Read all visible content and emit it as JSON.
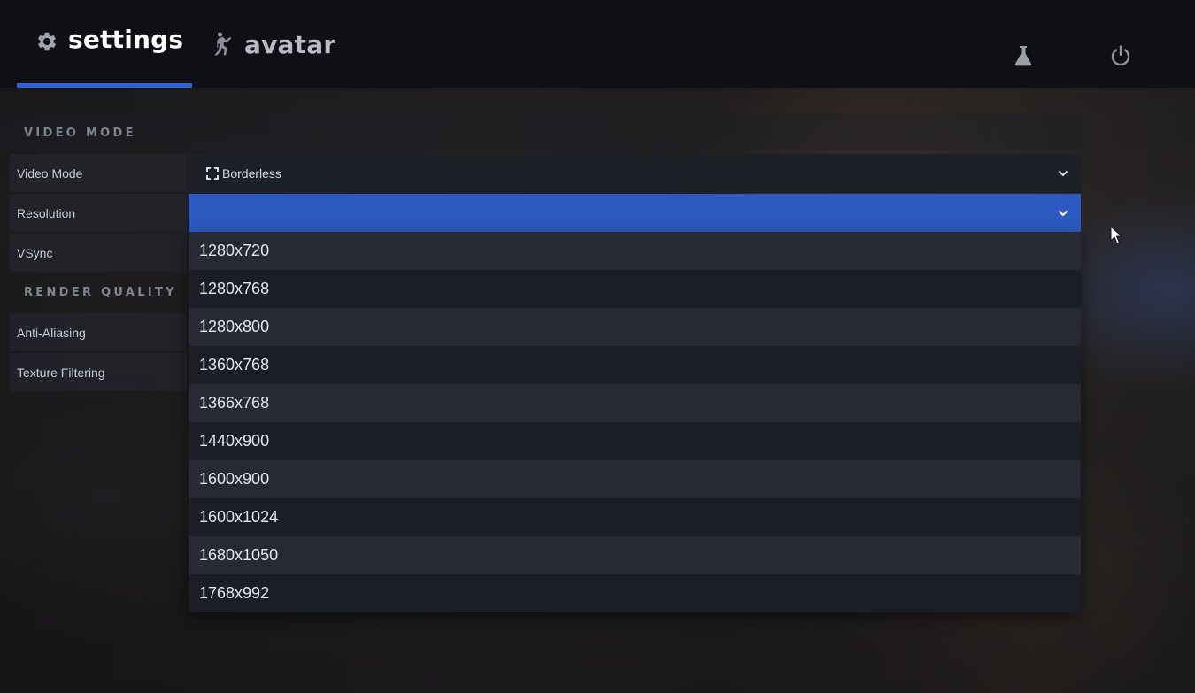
{
  "tabs": {
    "settings": {
      "label": "settings",
      "icon": "gear-icon",
      "active": true
    },
    "avatar": {
      "label": "avatar",
      "icon": "person-icon",
      "active": false
    }
  },
  "topbar_icons": [
    "flask-icon",
    "power-icon"
  ],
  "accent_color": "#2f63d3",
  "sections": {
    "video_mode": "VIDEO MODE",
    "render_quality": "RENDER QUALITY"
  },
  "settings": {
    "video_mode": {
      "label": "Video Mode",
      "value": "Borderless",
      "value_icon": "fullscreen-icon"
    },
    "resolution": {
      "label": "Resolution",
      "value": ""
    },
    "vsync": {
      "label": "VSync"
    },
    "anti_aliasing": {
      "label": "Anti-Aliasing"
    },
    "texture_filtering": {
      "label": "Texture Filtering"
    }
  },
  "resolution_options": [
    "1280x720",
    "1280x768",
    "1280x800",
    "1360x768",
    "1366x768",
    "1440x900",
    "1600x900",
    "1600x1024",
    "1680x1050",
    "1768x992"
  ]
}
